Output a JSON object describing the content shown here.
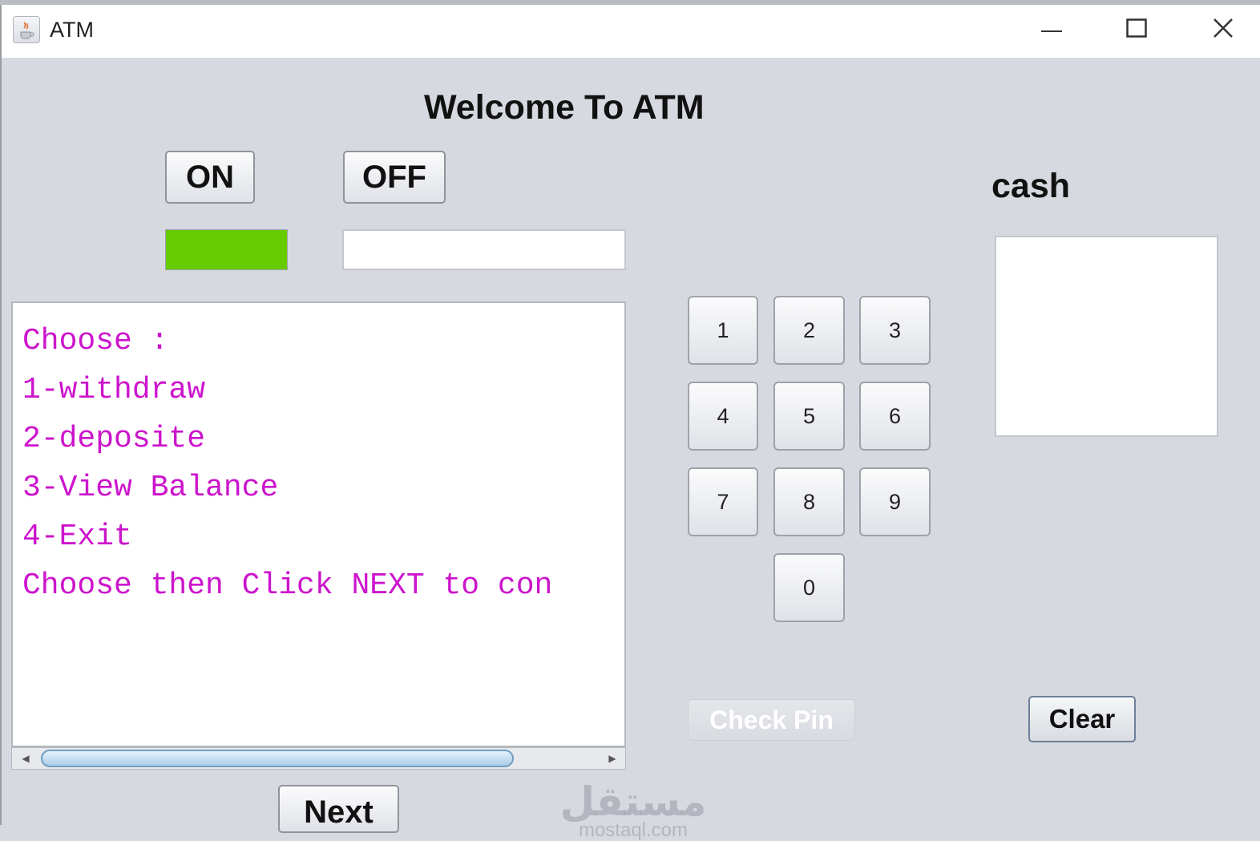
{
  "window": {
    "title": "ATM",
    "icons": {
      "app": "java-cup-icon",
      "minimize": "minimize-icon",
      "maximize": "maximize-icon",
      "close": "close-icon"
    }
  },
  "header": {
    "title": "Welcome To ATM"
  },
  "power": {
    "on_label": "ON",
    "off_label": "OFF",
    "indicator_color": "#66cc00"
  },
  "screen": {
    "text_color": "#cc14cc",
    "lines": [
      "Choose :",
      "1-withdraw",
      "2-deposite",
      "3-View Balance",
      "4-Exit",
      "Choose then Click NEXT to con"
    ]
  },
  "keypad": {
    "keys": [
      "1",
      "2",
      "3",
      "4",
      "5",
      "6",
      "7",
      "8",
      "9",
      "0"
    ]
  },
  "cash": {
    "label": "cash"
  },
  "actions": {
    "check_pin": "Check Pin",
    "clear": "Clear",
    "next": "Next"
  },
  "watermark": {
    "arabic": "مستقل",
    "url": "mostaql.com"
  }
}
